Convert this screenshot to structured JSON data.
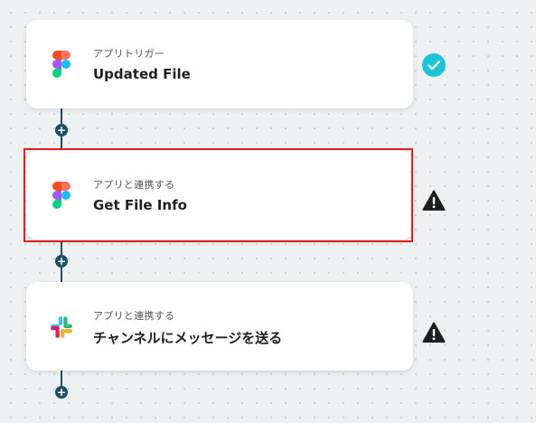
{
  "steps": [
    {
      "subtitle": "アプリトリガー",
      "title": "Updated File",
      "app_icon": "figma-icon",
      "status": "success-check-icon"
    },
    {
      "subtitle": "アプリと連携する",
      "title": "Get File Info",
      "app_icon": "figma-icon",
      "status": "warning-icon"
    },
    {
      "subtitle": "アプリと連携する",
      "title": "チャンネルにメッセージを送る",
      "app_icon": "slack-icon",
      "status": "warning-icon"
    }
  ],
  "add_step_symbol": "+",
  "colors": {
    "connector": "#1d4f66",
    "success": "#1fc3d8",
    "warning": "#1f1f1f",
    "highlight": "#e02020"
  }
}
